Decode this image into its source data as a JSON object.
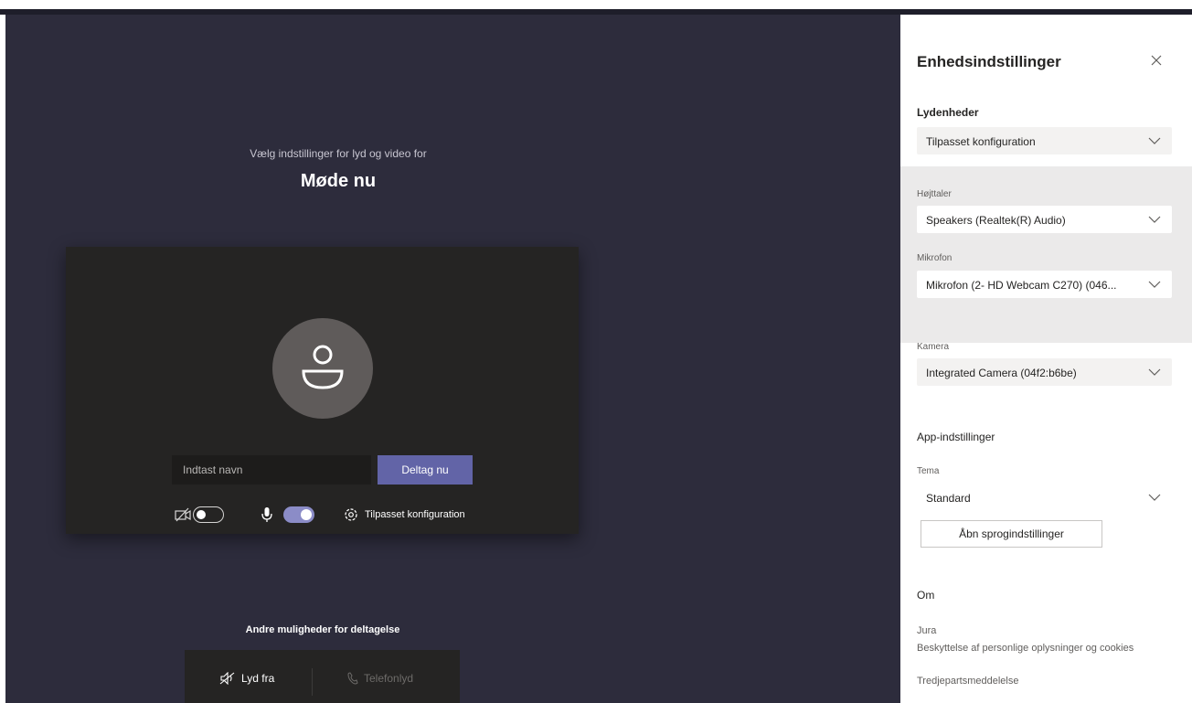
{
  "prejoin": {
    "subtitle": "Vælg indstillinger for lyd og video for",
    "meeting_title": "Møde nu",
    "name_placeholder": "Indtast navn",
    "join_label": "Deltag nu",
    "camera_on": false,
    "mic_on": true,
    "device_config_label": "Tilpasset konfiguration",
    "other_options_title": "Andre muligheder for deltagelse",
    "audio_off_label": "Lyd fra",
    "phone_audio_label": "Telefonlyd"
  },
  "settings_panel": {
    "title": "Enhedsindstillinger",
    "audio_devices_heading": "Lydenheder",
    "audio_config_value": "Tilpasset konfiguration",
    "speaker_label": "Højttaler",
    "speaker_value": "Speakers (Realtek(R) Audio)",
    "mic_label": "Mikrofon",
    "mic_value": "Mikrofon (2- HD Webcam C270) (046...",
    "camera_label": "Kamera",
    "camera_value": "Integrated Camera (04f2:b6be)",
    "app_settings_heading": "App-indstillinger",
    "theme_label": "Tema",
    "theme_value": "Standard",
    "language_button": "Åbn sprogindstillinger",
    "about_heading": "Om",
    "links": [
      "Jura",
      "Beskyttelse af personlige oplysninger og cookies",
      "Tredjepartsmeddelelse"
    ]
  },
  "colors": {
    "accent": "#6264a7",
    "toggle_on": "#8b8cc7",
    "background": "#2d2c3c"
  }
}
